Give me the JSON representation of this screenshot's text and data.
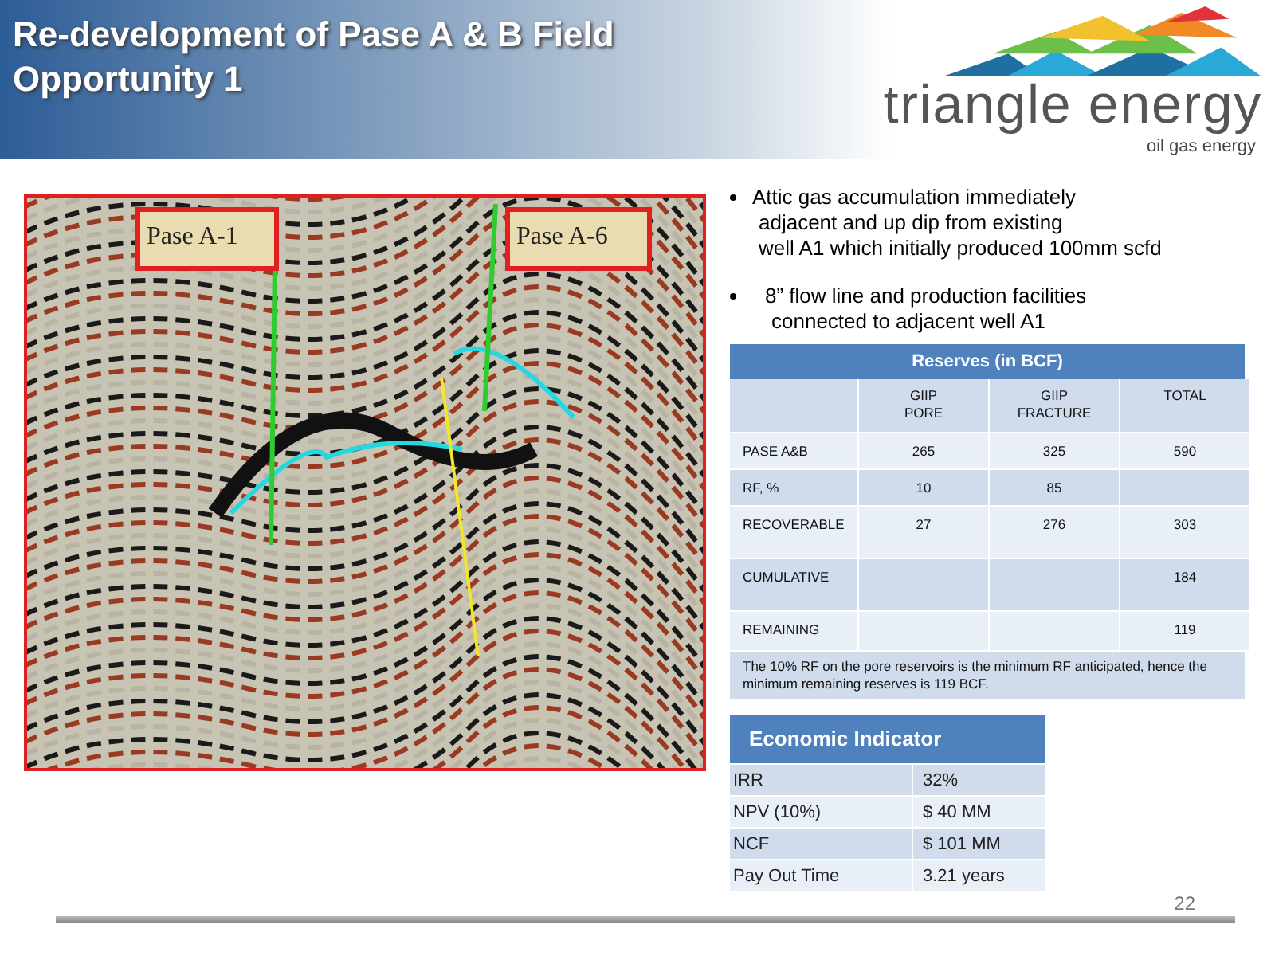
{
  "header": {
    "title_lines": [
      "Re-development of Pase A & B Field",
      "Opportunity 1"
    ]
  },
  "logo": {
    "name": "triangle energy",
    "tagline": "oil gas energy"
  },
  "figure": {
    "labels": [
      "Pase A-1",
      "Pase A-6"
    ]
  },
  "bullets": [
    {
      "lines": [
        "Attic gas accumulation immediately",
        "adjacent and up dip from existing",
        "well A1 which initially produced 100mm scfd"
      ]
    },
    {
      "lines": [
        "8” flow line and production facilities",
        "connected to adjacent well A1"
      ]
    }
  ],
  "reserves": {
    "title": "Reserves (in BCF)",
    "columns": [
      "",
      "GIIP\nPORE",
      "GIIP\nFRACTURE",
      "TOTAL"
    ],
    "rows": [
      [
        "PASE A&B",
        "265",
        "325",
        "590"
      ],
      [
        "RF, %",
        "10",
        "85",
        ""
      ],
      [
        "RECOVERABLE",
        "27",
        "276",
        "303"
      ],
      [
        "CUMULATIVE",
        "",
        "",
        "184"
      ],
      [
        "REMAINING",
        "",
        "",
        "119"
      ]
    ],
    "note": "The 10% RF on the pore reservoirs is the minimum RF anticipated, hence the minimum remaining reserves is 119 BCF."
  },
  "economic": {
    "title": "Economic Indicator",
    "rows": [
      [
        "IRR",
        "32%"
      ],
      [
        "NPV (10%)",
        "$ 40 MM"
      ],
      [
        "NCF",
        "$ 101 MM"
      ],
      [
        "Pay Out Time",
        "3.21 years"
      ]
    ]
  },
  "page_number": "22"
}
